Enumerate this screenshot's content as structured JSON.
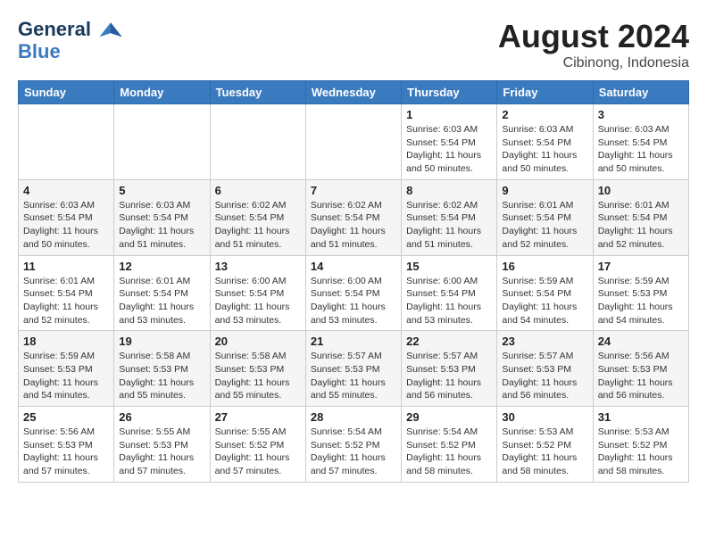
{
  "header": {
    "logo_line1": "General",
    "logo_line2": "Blue",
    "month_year": "August 2024",
    "location": "Cibinong, Indonesia"
  },
  "days_of_week": [
    "Sunday",
    "Monday",
    "Tuesday",
    "Wednesday",
    "Thursday",
    "Friday",
    "Saturday"
  ],
  "weeks": [
    [
      {
        "day": "",
        "info": ""
      },
      {
        "day": "",
        "info": ""
      },
      {
        "day": "",
        "info": ""
      },
      {
        "day": "",
        "info": ""
      },
      {
        "day": "1",
        "info": "Sunrise: 6:03 AM\nSunset: 5:54 PM\nDaylight: 11 hours\nand 50 minutes."
      },
      {
        "day": "2",
        "info": "Sunrise: 6:03 AM\nSunset: 5:54 PM\nDaylight: 11 hours\nand 50 minutes."
      },
      {
        "day": "3",
        "info": "Sunrise: 6:03 AM\nSunset: 5:54 PM\nDaylight: 11 hours\nand 50 minutes."
      }
    ],
    [
      {
        "day": "4",
        "info": "Sunrise: 6:03 AM\nSunset: 5:54 PM\nDaylight: 11 hours\nand 50 minutes."
      },
      {
        "day": "5",
        "info": "Sunrise: 6:03 AM\nSunset: 5:54 PM\nDaylight: 11 hours\nand 51 minutes."
      },
      {
        "day": "6",
        "info": "Sunrise: 6:02 AM\nSunset: 5:54 PM\nDaylight: 11 hours\nand 51 minutes."
      },
      {
        "day": "7",
        "info": "Sunrise: 6:02 AM\nSunset: 5:54 PM\nDaylight: 11 hours\nand 51 minutes."
      },
      {
        "day": "8",
        "info": "Sunrise: 6:02 AM\nSunset: 5:54 PM\nDaylight: 11 hours\nand 51 minutes."
      },
      {
        "day": "9",
        "info": "Sunrise: 6:01 AM\nSunset: 5:54 PM\nDaylight: 11 hours\nand 52 minutes."
      },
      {
        "day": "10",
        "info": "Sunrise: 6:01 AM\nSunset: 5:54 PM\nDaylight: 11 hours\nand 52 minutes."
      }
    ],
    [
      {
        "day": "11",
        "info": "Sunrise: 6:01 AM\nSunset: 5:54 PM\nDaylight: 11 hours\nand 52 minutes."
      },
      {
        "day": "12",
        "info": "Sunrise: 6:01 AM\nSunset: 5:54 PM\nDaylight: 11 hours\nand 53 minutes."
      },
      {
        "day": "13",
        "info": "Sunrise: 6:00 AM\nSunset: 5:54 PM\nDaylight: 11 hours\nand 53 minutes."
      },
      {
        "day": "14",
        "info": "Sunrise: 6:00 AM\nSunset: 5:54 PM\nDaylight: 11 hours\nand 53 minutes."
      },
      {
        "day": "15",
        "info": "Sunrise: 6:00 AM\nSunset: 5:54 PM\nDaylight: 11 hours\nand 53 minutes."
      },
      {
        "day": "16",
        "info": "Sunrise: 5:59 AM\nSunset: 5:54 PM\nDaylight: 11 hours\nand 54 minutes."
      },
      {
        "day": "17",
        "info": "Sunrise: 5:59 AM\nSunset: 5:53 PM\nDaylight: 11 hours\nand 54 minutes."
      }
    ],
    [
      {
        "day": "18",
        "info": "Sunrise: 5:59 AM\nSunset: 5:53 PM\nDaylight: 11 hours\nand 54 minutes."
      },
      {
        "day": "19",
        "info": "Sunrise: 5:58 AM\nSunset: 5:53 PM\nDaylight: 11 hours\nand 55 minutes."
      },
      {
        "day": "20",
        "info": "Sunrise: 5:58 AM\nSunset: 5:53 PM\nDaylight: 11 hours\nand 55 minutes."
      },
      {
        "day": "21",
        "info": "Sunrise: 5:57 AM\nSunset: 5:53 PM\nDaylight: 11 hours\nand 55 minutes."
      },
      {
        "day": "22",
        "info": "Sunrise: 5:57 AM\nSunset: 5:53 PM\nDaylight: 11 hours\nand 56 minutes."
      },
      {
        "day": "23",
        "info": "Sunrise: 5:57 AM\nSunset: 5:53 PM\nDaylight: 11 hours\nand 56 minutes."
      },
      {
        "day": "24",
        "info": "Sunrise: 5:56 AM\nSunset: 5:53 PM\nDaylight: 11 hours\nand 56 minutes."
      }
    ],
    [
      {
        "day": "25",
        "info": "Sunrise: 5:56 AM\nSunset: 5:53 PM\nDaylight: 11 hours\nand 57 minutes."
      },
      {
        "day": "26",
        "info": "Sunrise: 5:55 AM\nSunset: 5:53 PM\nDaylight: 11 hours\nand 57 minutes."
      },
      {
        "day": "27",
        "info": "Sunrise: 5:55 AM\nSunset: 5:52 PM\nDaylight: 11 hours\nand 57 minutes."
      },
      {
        "day": "28",
        "info": "Sunrise: 5:54 AM\nSunset: 5:52 PM\nDaylight: 11 hours\nand 57 minutes."
      },
      {
        "day": "29",
        "info": "Sunrise: 5:54 AM\nSunset: 5:52 PM\nDaylight: 11 hours\nand 58 minutes."
      },
      {
        "day": "30",
        "info": "Sunrise: 5:53 AM\nSunset: 5:52 PM\nDaylight: 11 hours\nand 58 minutes."
      },
      {
        "day": "31",
        "info": "Sunrise: 5:53 AM\nSunset: 5:52 PM\nDaylight: 11 hours\nand 58 minutes."
      }
    ]
  ]
}
